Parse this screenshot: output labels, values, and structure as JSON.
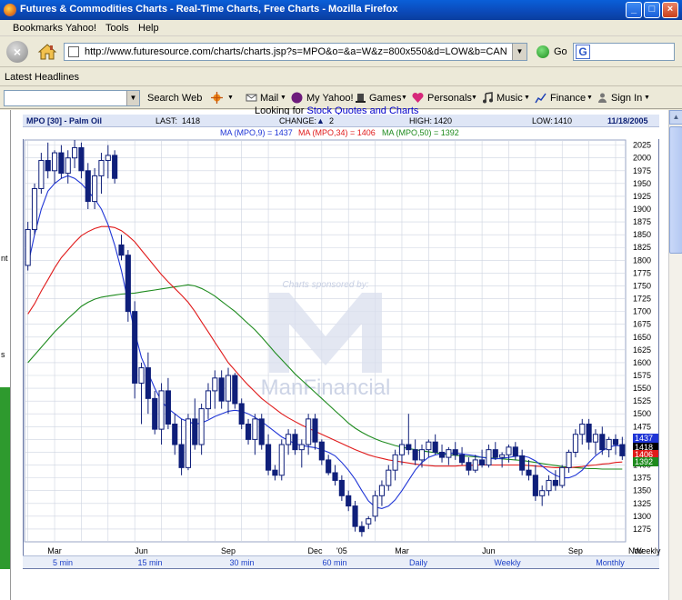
{
  "window": {
    "title": "Futures & Commodities Charts - Real-Time Charts, Free Charts - Mozilla Firefox",
    "minimize_label": "_",
    "maximize_label": "□",
    "close_label": "×"
  },
  "menu": [
    "Bookmarks",
    "Yahoo!",
    "Tools",
    "Help"
  ],
  "nav": {
    "stop_label": "×",
    "url": "http://www.futuresource.com/charts/charts.jsp?s=MPO&o=&a=W&z=800x550&d=LOW&b=CANDLE&st=MA?",
    "go_label": "Go",
    "search_engine": "G"
  },
  "bookmarks_bar": {
    "item": "Latest Headlines"
  },
  "yahoo_toolbar": {
    "search_button": "Search Web",
    "items": [
      "Mail",
      "My Yahoo!",
      "Games",
      "Personals",
      "Music",
      "Finance",
      "Sign In"
    ]
  },
  "left_strip": {
    "text_top": "nt",
    "text_bottom": "s"
  },
  "page": {
    "looking_prefix": "Looking for ",
    "looking_link": "Stock Quotes and Charts"
  },
  "chart_header": {
    "symbol": "MPO [30] - Palm Oil",
    "last_label": "LAST:",
    "last_value": "1418",
    "change_label": "CHANGE:",
    "change_arrow": "▲",
    "change_value": "2",
    "high_label": "HIGH:",
    "high_value": "1420",
    "low_label": "LOW:",
    "low_value": "1410",
    "date": "11/18/2005",
    "ma9_label": "MA (MPO,9) = 1437",
    "ma34_label": "MA (MPO,34) = 1406",
    "ma50_label": "MA (MPO,50) = 1392"
  },
  "watermark": {
    "sponsor": "Charts sponsored by:",
    "brand": "ManFinancial"
  },
  "colors": {
    "ma9": "#1f35d6",
    "ma34": "#e01a1a",
    "ma50": "#1d8a1d",
    "candle_up": "#ffffff",
    "candle_down": "#0f1f7a",
    "grid": "#cdd3e0"
  },
  "periods": [
    "5 min",
    "15 min",
    "30 min",
    "60 min",
    "Daily",
    "Weekly",
    "Monthly"
  ],
  "badges": {
    "b1": {
      "value": "1437",
      "color": "#1f35d6"
    },
    "b2": {
      "value": "1418",
      "color": "#000000"
    },
    "b3": {
      "value": "1406",
      "color": "#e01a1a"
    },
    "b4": {
      "value": "1392",
      "color": "#1d8a1d"
    }
  },
  "chart_data": {
    "type": "candlestick",
    "interval_label": "Weekly",
    "ylim": [
      1250,
      2035
    ],
    "yticks": [
      2025,
      2000,
      1975,
      1950,
      1925,
      1900,
      1875,
      1850,
      1825,
      1800,
      1775,
      1750,
      1725,
      1700,
      1675,
      1650,
      1625,
      1600,
      1575,
      1550,
      1525,
      1500,
      1475,
      1450,
      1425,
      1400,
      1375,
      1350,
      1325,
      1300,
      1275
    ],
    "xticks": [
      {
        "label": "Mar",
        "index": 4
      },
      {
        "label": "Jun",
        "index": 17
      },
      {
        "label": "Sep",
        "index": 30
      },
      {
        "label": "Dec",
        "index": 43
      },
      {
        "label": "'05",
        "index": 47
      },
      {
        "label": "Mar",
        "index": 56
      },
      {
        "label": "Jun",
        "index": 69
      },
      {
        "label": "Sep",
        "index": 82
      },
      {
        "label": "Nov",
        "index": 91
      }
    ],
    "candles": [
      [
        1790,
        1875,
        1780,
        1860
      ],
      [
        1860,
        1950,
        1850,
        1940
      ],
      [
        1940,
        2010,
        1930,
        1995
      ],
      [
        1995,
        2030,
        1960,
        1975
      ],
      [
        1975,
        2015,
        1950,
        2010
      ],
      [
        2010,
        2025,
        1960,
        1970
      ],
      [
        1970,
        2015,
        1950,
        2000
      ],
      [
        2000,
        2035,
        1980,
        2020
      ],
      [
        2020,
        2030,
        1960,
        1975
      ],
      [
        1975,
        1990,
        1900,
        1915
      ],
      [
        1915,
        1980,
        1900,
        1965
      ],
      [
        1965,
        2010,
        1930,
        1995
      ],
      [
        1995,
        2025,
        1960,
        2005
      ],
      [
        2005,
        2015,
        1950,
        1960
      ],
      [
        1830,
        1850,
        1800,
        1810
      ],
      [
        1810,
        1820,
        1680,
        1700
      ],
      [
        1700,
        1720,
        1530,
        1560
      ],
      [
        1560,
        1600,
        1480,
        1590
      ],
      [
        1590,
        1620,
        1500,
        1530
      ],
      [
        1530,
        1545,
        1460,
        1470
      ],
      [
        1470,
        1560,
        1440,
        1545
      ],
      [
        1545,
        1570,
        1470,
        1480
      ],
      [
        1480,
        1500,
        1420,
        1440
      ],
      [
        1440,
        1490,
        1380,
        1395
      ],
      [
        1395,
        1500,
        1390,
        1490
      ],
      [
        1490,
        1530,
        1430,
        1440
      ],
      [
        1440,
        1520,
        1420,
        1510
      ],
      [
        1510,
        1560,
        1490,
        1545
      ],
      [
        1545,
        1585,
        1510,
        1570
      ],
      [
        1570,
        1585,
        1510,
        1525
      ],
      [
        1525,
        1590,
        1500,
        1575
      ],
      [
        1575,
        1580,
        1510,
        1520
      ],
      [
        1520,
        1530,
        1470,
        1480
      ],
      [
        1480,
        1490,
        1440,
        1450
      ],
      [
        1450,
        1500,
        1420,
        1490
      ],
      [
        1490,
        1500,
        1430,
        1440
      ],
      [
        1440,
        1460,
        1380,
        1390
      ],
      [
        1390,
        1400,
        1370,
        1380
      ],
      [
        1380,
        1450,
        1370,
        1440
      ],
      [
        1440,
        1470,
        1420,
        1460
      ],
      [
        1460,
        1470,
        1420,
        1430
      ],
      [
        1430,
        1450,
        1395,
        1440
      ],
      [
        1440,
        1500,
        1420,
        1490
      ],
      [
        1490,
        1500,
        1430,
        1445
      ],
      [
        1445,
        1450,
        1400,
        1410
      ],
      [
        1410,
        1420,
        1380,
        1385
      ],
      [
        1385,
        1400,
        1360,
        1370
      ],
      [
        1370,
        1380,
        1330,
        1340
      ],
      [
        1340,
        1350,
        1310,
        1320
      ],
      [
        1320,
        1330,
        1270,
        1280
      ],
      [
        1280,
        1290,
        1260,
        1270
      ],
      [
        1285,
        1300,
        1275,
        1295
      ],
      [
        1300,
        1350,
        1290,
        1340
      ],
      [
        1340,
        1370,
        1320,
        1360
      ],
      [
        1360,
        1400,
        1350,
        1390
      ],
      [
        1390,
        1430,
        1370,
        1420
      ],
      [
        1420,
        1450,
        1400,
        1440
      ],
      [
        1440,
        1500,
        1420,
        1430
      ],
      [
        1430,
        1450,
        1400,
        1410
      ],
      [
        1410,
        1440,
        1395,
        1430
      ],
      [
        1430,
        1450,
        1415,
        1445
      ],
      [
        1445,
        1460,
        1420,
        1425
      ],
      [
        1425,
        1440,
        1405,
        1415
      ],
      [
        1415,
        1435,
        1400,
        1430
      ],
      [
        1430,
        1445,
        1410,
        1420
      ],
      [
        1420,
        1435,
        1400,
        1405
      ],
      [
        1405,
        1415,
        1380,
        1390
      ],
      [
        1390,
        1420,
        1385,
        1410
      ],
      [
        1410,
        1430,
        1395,
        1400
      ],
      [
        1400,
        1440,
        1395,
        1430
      ],
      [
        1430,
        1445,
        1410,
        1415
      ],
      [
        1415,
        1425,
        1395,
        1420
      ],
      [
        1420,
        1440,
        1405,
        1435
      ],
      [
        1435,
        1445,
        1410,
        1418
      ],
      [
        1418,
        1430,
        1380,
        1390
      ],
      [
        1390,
        1410,
        1370,
        1380
      ],
      [
        1380,
        1400,
        1330,
        1340
      ],
      [
        1340,
        1360,
        1320,
        1350
      ],
      [
        1350,
        1380,
        1340,
        1370
      ],
      [
        1370,
        1390,
        1350,
        1360
      ],
      [
        1360,
        1400,
        1355,
        1395
      ],
      [
        1395,
        1430,
        1385,
        1425
      ],
      [
        1425,
        1470,
        1415,
        1460
      ],
      [
        1460,
        1490,
        1440,
        1480
      ],
      [
        1480,
        1490,
        1430,
        1445
      ],
      [
        1445,
        1470,
        1420,
        1460
      ],
      [
        1460,
        1475,
        1420,
        1430
      ],
      [
        1430,
        1455,
        1415,
        1450
      ],
      [
        1450,
        1460,
        1420,
        1440
      ],
      [
        1440,
        1455,
        1410,
        1418
      ]
    ],
    "ma9": [
      1790,
      1850,
      1900,
      1935,
      1950,
      1960,
      1965,
      1960,
      1950,
      1935,
      1920,
      1900,
      1870,
      1830,
      1780,
      1720,
      1660,
      1610,
      1580,
      1550,
      1525,
      1510,
      1500,
      1490,
      1485,
      1480,
      1482,
      1488,
      1495,
      1500,
      1505,
      1507,
      1505,
      1500,
      1493,
      1485,
      1475,
      1465,
      1455,
      1448,
      1442,
      1438,
      1436,
      1434,
      1430,
      1425,
      1418,
      1405,
      1390,
      1372,
      1350,
      1330,
      1318,
      1315,
      1320,
      1332,
      1350,
      1370,
      1390,
      1405,
      1415,
      1420,
      1422,
      1423,
      1423,
      1422,
      1420,
      1418,
      1415,
      1413,
      1412,
      1413,
      1415,
      1417,
      1418,
      1415,
      1408,
      1398,
      1388,
      1380,
      1375,
      1375,
      1380,
      1390,
      1405,
      1418,
      1428,
      1435,
      1438,
      1437
    ],
    "ma34": [
      1695,
      1715,
      1740,
      1762,
      1785,
      1805,
      1820,
      1835,
      1848,
      1856,
      1862,
      1866,
      1866,
      1864,
      1858,
      1848,
      1836,
      1820,
      1804,
      1788,
      1772,
      1758,
      1745,
      1732,
      1718,
      1700,
      1680,
      1660,
      1640,
      1620,
      1600,
      1585,
      1570,
      1556,
      1543,
      1530,
      1520,
      1510,
      1500,
      1492,
      1485,
      1478,
      1472,
      1466,
      1460,
      1454,
      1448,
      1442,
      1436,
      1430,
      1425,
      1420,
      1416,
      1413,
      1410,
      1408,
      1406,
      1404,
      1402,
      1400,
      1399,
      1398,
      1398,
      1398,
      1398,
      1399,
      1399,
      1400,
      1400,
      1400,
      1400,
      1400,
      1400,
      1400,
      1400,
      1399,
      1398,
      1397,
      1396,
      1395,
      1395,
      1395,
      1396,
      1397,
      1399,
      1400,
      1402,
      1403,
      1405,
      1406
    ],
    "ma50": [
      1600,
      1615,
      1630,
      1645,
      1660,
      1673,
      1686,
      1698,
      1710,
      1718,
      1724,
      1728,
      1730,
      1732,
      1734,
      1735,
      1736,
      1738,
      1740,
      1742,
      1744,
      1746,
      1748,
      1750,
      1752,
      1750,
      1745,
      1738,
      1730,
      1720,
      1710,
      1700,
      1688,
      1676,
      1664,
      1650,
      1635,
      1620,
      1606,
      1592,
      1578,
      1566,
      1554,
      1542,
      1530,
      1518,
      1506,
      1494,
      1482,
      1472,
      1464,
      1457,
      1451,
      1446,
      1442,
      1438,
      1435,
      1432,
      1430,
      1428,
      1426,
      1424,
      1422,
      1420,
      1419,
      1418,
      1417,
      1416,
      1415,
      1414,
      1413,
      1412,
      1411,
      1410,
      1409,
      1407,
      1405,
      1403,
      1401,
      1399,
      1397,
      1396,
      1395,
      1394,
      1393,
      1393,
      1392,
      1392,
      1392,
      1392
    ]
  }
}
